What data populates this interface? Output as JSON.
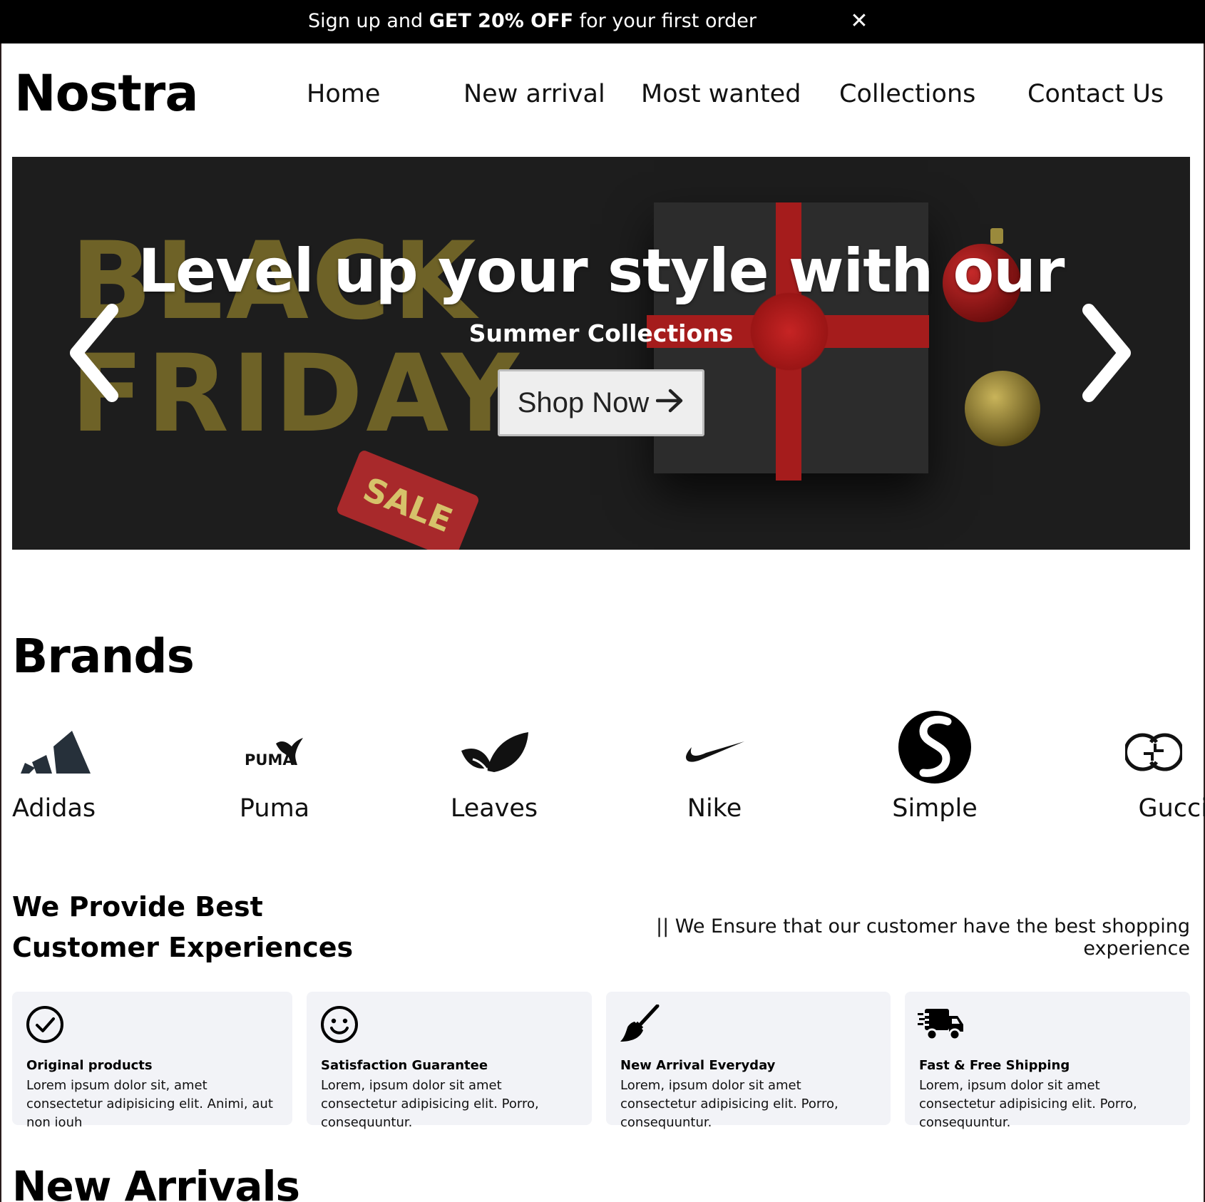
{
  "announcement": {
    "prefix": "Sign up and ",
    "highlight": "GET 20% OFF",
    "suffix": " for your first order",
    "close_icon": "close-icon"
  },
  "header": {
    "logo": "Nostra",
    "nav": [
      "Home",
      "New arrival",
      "Most wanted",
      "Collections",
      "Contact Us"
    ]
  },
  "hero": {
    "title": "Level up your style with our",
    "subtitle": "Summer Collections",
    "cta_label": "Shop Now",
    "cta_icon": "arrow-right-icon",
    "bg_text_line1": "BLACK",
    "bg_text_line2": "FRIDAY",
    "tag_text": "SALE",
    "prev_icon": "chevron-left-icon",
    "next_icon": "chevron-right-icon"
  },
  "brands": {
    "heading": "Brands",
    "items": [
      {
        "name": "Adidas",
        "icon": "adidas-logo-icon"
      },
      {
        "name": "Puma",
        "icon": "puma-logo-icon",
        "wordmark": "PUMA"
      },
      {
        "name": "Leaves",
        "icon": "leaves-logo-icon"
      },
      {
        "name": "Nike",
        "icon": "nike-swoosh-icon"
      },
      {
        "name": "Simple",
        "icon": "simple-logo-icon"
      },
      {
        "name": "Gucci",
        "icon": "gucci-logo-icon"
      }
    ]
  },
  "experience": {
    "heading_line1": "We Provide Best",
    "heading_line2": "Customer Experiences",
    "tagline": "|| We Ensure that our customer have the best shopping experience",
    "cards": [
      {
        "title": "Original products",
        "desc": "Lorem ipsum dolor sit, amet consectetur adipisicing elit. Animi, aut non iouh",
        "icon": "check-circle-icon"
      },
      {
        "title": "Satisfaction Guarantee",
        "desc": "Lorem, ipsum dolor sit amet consectetur adipisicing elit. Porro, consequuntur.",
        "icon": "smile-icon"
      },
      {
        "title": "New Arrival Everyday",
        "desc": "Lorem, ipsum dolor sit amet consectetur adipisicing elit. Porro, consequuntur.",
        "icon": "broom-icon"
      },
      {
        "title": "Fast & Free Shipping",
        "desc": "Lorem, ipsum dolor sit amet consectetur adipisicing elit. Porro, consequuntur.",
        "icon": "fast-truck-icon"
      }
    ]
  },
  "new_arrivals": {
    "heading": "New Arrivals"
  }
}
